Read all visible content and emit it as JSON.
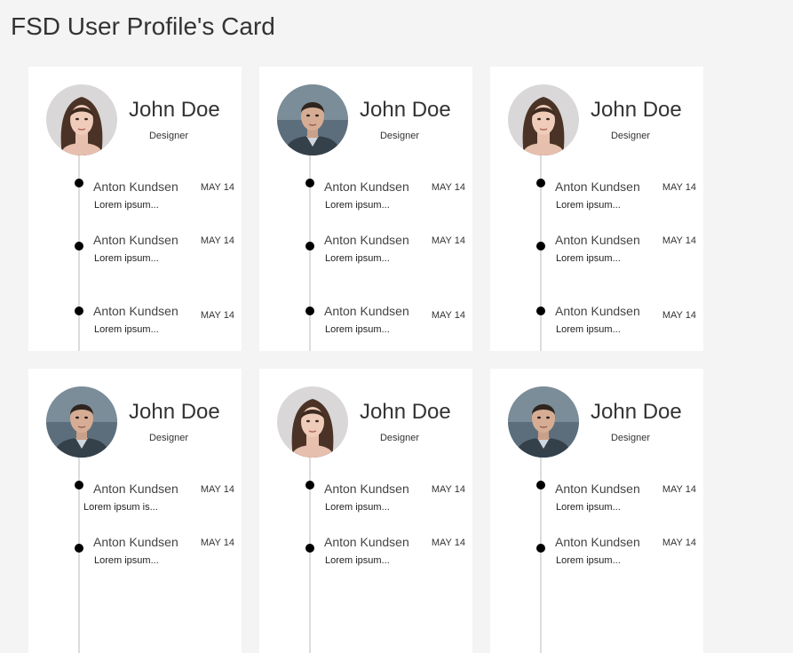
{
  "page": {
    "title": "FSD User Profile's Card"
  },
  "cards": [
    {
      "name": "John Doe",
      "role": "Designer",
      "avatar": "woman-portrait",
      "items": [
        {
          "author": "Anton Kundsen",
          "date": "MAY 14",
          "text": "Lorem ipsum..."
        },
        {
          "author": "Anton Kundsen",
          "date": "MAY 14",
          "text": "Lorem ipsum..."
        },
        {
          "author": "Anton Kundsen",
          "date": "MAY 14",
          "text": "Lorem ipsum..."
        }
      ]
    },
    {
      "name": "John Doe",
      "role": "Designer",
      "avatar": "man-portrait",
      "items": [
        {
          "author": "Anton Kundsen",
          "date": "MAY 14",
          "text": "Lorem ipsum..."
        },
        {
          "author": "Anton Kundsen",
          "date": "MAY 14",
          "text": "Lorem ipsum..."
        },
        {
          "author": "Anton Kundsen",
          "date": "MAY 14",
          "text": "Lorem ipsum..."
        }
      ]
    },
    {
      "name": "John Doe",
      "role": "Designer",
      "avatar": "woman-portrait",
      "items": [
        {
          "author": "Anton Kundsen",
          "date": "MAY 14",
          "text": "Lorem ipsum..."
        },
        {
          "author": "Anton Kundsen",
          "date": "MAY 14",
          "text": "Lorem ipsum..."
        },
        {
          "author": "Anton Kundsen",
          "date": "MAY 14",
          "text": "Lorem ipsum..."
        }
      ]
    },
    {
      "name": "John Doe",
      "role": "Designer",
      "avatar": "man-portrait",
      "items": [
        {
          "author": "Anton Kundsen",
          "date": "MAY 14",
          "text": "Lorem ipsum is..."
        },
        {
          "author": "Anton Kundsen",
          "date": "MAY 14",
          "text": "Lorem ipsum..."
        },
        {
          "author": "",
          "date": "",
          "text": ""
        }
      ]
    },
    {
      "name": "John Doe",
      "role": "Designer",
      "avatar": "woman-portrait",
      "items": [
        {
          "author": "Anton Kundsen",
          "date": "MAY 14",
          "text": "Lorem ipsum..."
        },
        {
          "author": "Anton Kundsen",
          "date": "MAY 14",
          "text": "Lorem ipsum..."
        },
        {
          "author": "",
          "date": "",
          "text": ""
        }
      ]
    },
    {
      "name": "John Doe",
      "role": "Designer",
      "avatar": "man-portrait",
      "items": [
        {
          "author": "Anton Kundsen",
          "date": "MAY 14",
          "text": "Lorem ipsum..."
        },
        {
          "author": "Anton Kundsen",
          "date": "MAY 14",
          "text": "Lorem ipsum..."
        },
        {
          "author": "",
          "date": "",
          "text": ""
        }
      ]
    }
  ]
}
